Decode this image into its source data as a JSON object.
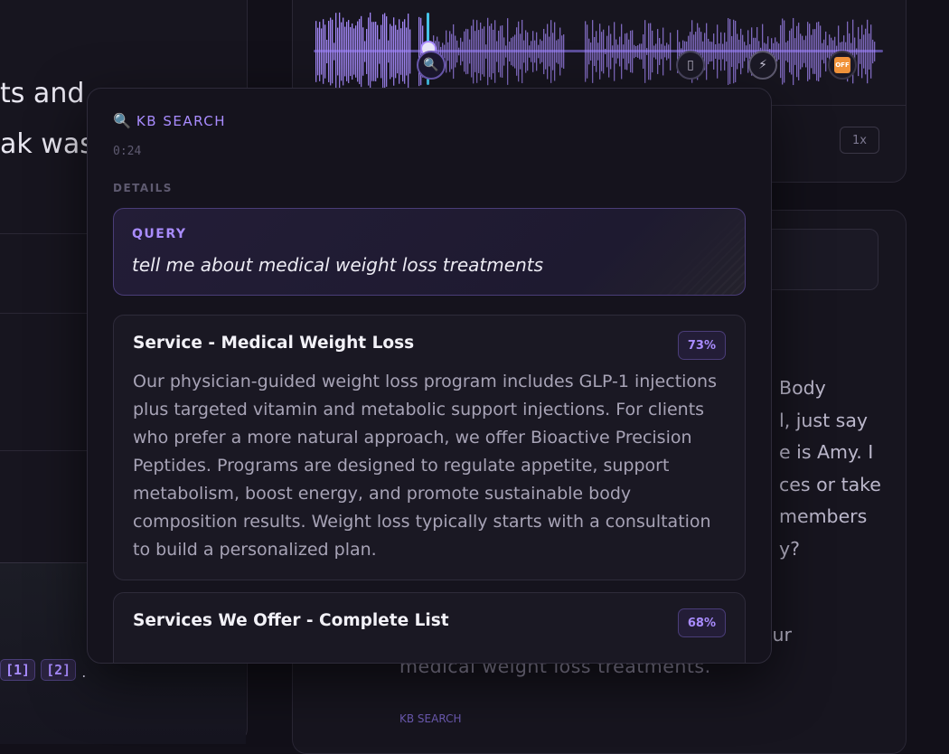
{
  "background": {
    "left_text_lines": [
      "ts and",
      "ak was"
    ],
    "citations": [
      "[1]",
      "[2]"
    ],
    "citation_trailer": ".",
    "speed_label": "1x",
    "right_text_lines": [
      "Body",
      "l, just say",
      "e is Amy. I",
      "ces or take",
      "members",
      "y?"
    ],
    "right_bottom_line1": "our",
    "right_bottom_line2": "medical weight loss treatments.",
    "right_bottom_line3": "KB SEARCH"
  },
  "timeline": {
    "marker_icons": [
      "search-icon",
      "phone-icon",
      "bolt-icon",
      "off-icon"
    ],
    "off_label": "OFF",
    "wave_color": "#a98cff"
  },
  "popup": {
    "title": "KB SEARCH",
    "time": "0:24",
    "section_label": "DETAILS",
    "query": {
      "label": "QUERY",
      "text": "tell me about medical weight loss treatments"
    },
    "results": [
      {
        "title": "Service - Medical Weight Loss",
        "score": "73%",
        "body": "Our physician-guided weight loss program includes GLP-1 injections plus targeted vitamin and metabolic support injections. For clients who prefer a more natural approach, we offer Bioactive Precision Peptides. Programs are designed to regulate appetite, support metabolism, boost energy, and promote sustainable body composition results. Weight loss typically starts with a consultation to build a personalized plan."
      },
      {
        "title": "Services We Offer - Complete List",
        "score": "68%"
      }
    ]
  },
  "colors": {
    "accent": "#a98cff",
    "background": "#121019",
    "playhead": "#45c3e8"
  }
}
